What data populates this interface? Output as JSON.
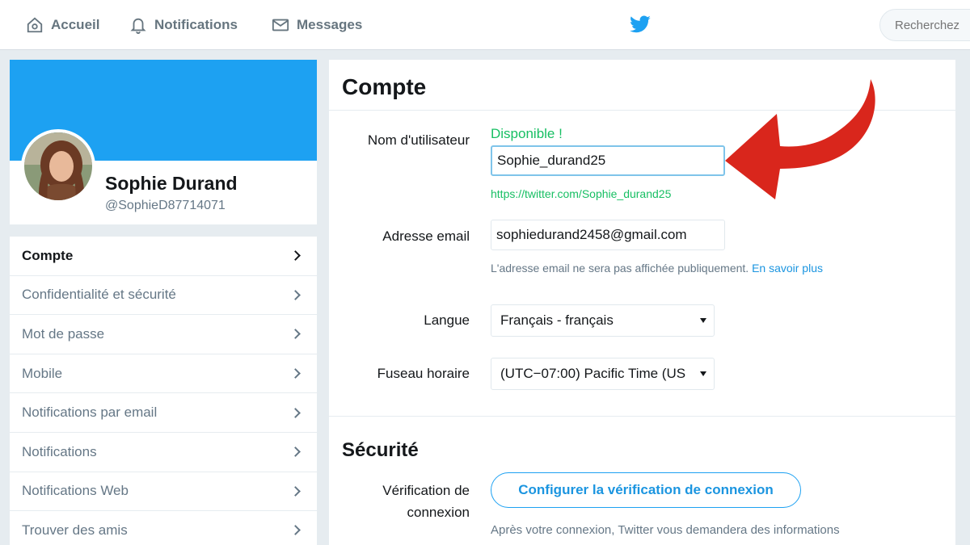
{
  "nav": {
    "home_label": "Accueil",
    "notifications_label": "Notifications",
    "messages_label": "Messages",
    "search_placeholder": "Recherchez"
  },
  "profile": {
    "name": "Sophie Durand",
    "handle": "@SophieD87714071"
  },
  "menu": {
    "items": [
      {
        "label": "Compte"
      },
      {
        "label": "Confidentialité et sécurité"
      },
      {
        "label": "Mot de passe"
      },
      {
        "label": "Mobile"
      },
      {
        "label": "Notifications par email"
      },
      {
        "label": "Notifications"
      },
      {
        "label": "Notifications Web"
      },
      {
        "label": "Trouver des amis"
      }
    ]
  },
  "account": {
    "title": "Compte",
    "username_label": "Nom d'utilisateur",
    "username_status": "Disponible !",
    "username_value": "Sophie_durand25",
    "username_url": "https://twitter.com/Sophie_durand25",
    "email_label": "Adresse email",
    "email_value": "sophiedurand2458@gmail.com",
    "email_helper": "L'adresse email ne sera pas affichée publiquement.",
    "email_helper_link": "En savoir plus",
    "language_label": "Langue",
    "language_value": "Français - français",
    "timezone_label": "Fuseau horaire",
    "timezone_value": "(UTC−07:00) Pacific Time (US"
  },
  "security": {
    "title": "Sécurité",
    "verification_label": "Vérification de connexion",
    "verification_button": "Configurer la vérification de connexion",
    "verification_helper": "Après votre connexion, Twitter vous demandera des informations"
  },
  "colors": {
    "brand_blue": "#1da1f2",
    "success_green": "#17bf63",
    "arrow_red": "#d9261c"
  }
}
